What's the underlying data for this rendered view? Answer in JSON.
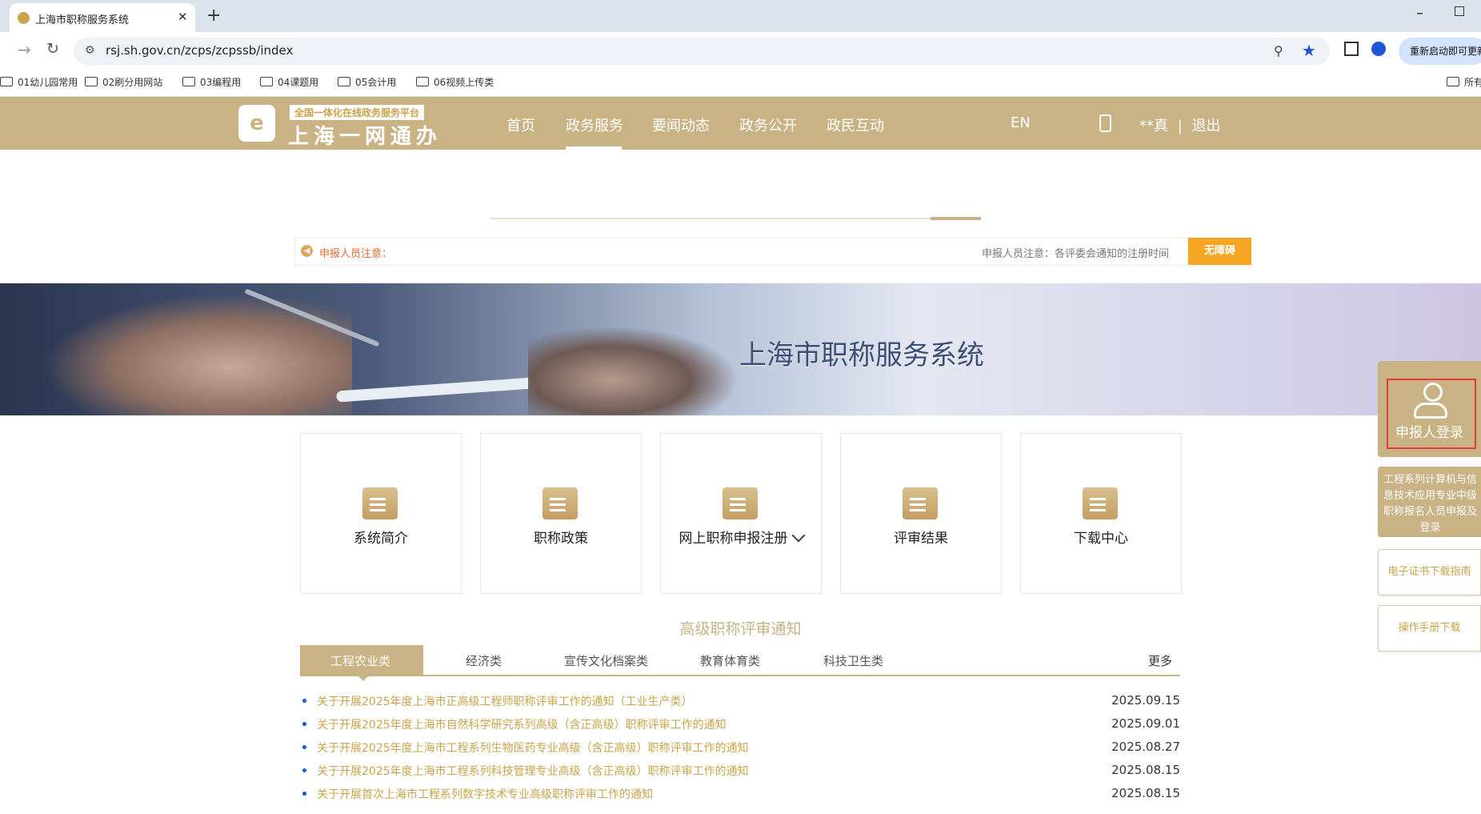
{
  "browser": {
    "tab_title": "上海市职称服务系统",
    "tab_close": "✕",
    "new_tab": "+",
    "url": "rsj.sh.gov.cn/zcps/zcpssb/index",
    "relaunch_label": "重新启动即可更新",
    "bookmarks": [
      "01幼儿园常用",
      "02刷分用网站",
      "03编程用",
      "04课题用",
      "05会计用",
      "06视频上传类"
    ],
    "bookmarks_right": "所有"
  },
  "header": {
    "logo_top": "全国一体化在线政务服务平台",
    "logo_main": "上海一网通办",
    "nav": [
      "首页",
      "政务服务",
      "要闻动态",
      "政务公开",
      "政民互动"
    ],
    "lang": "EN",
    "user_name": "**真",
    "separator": "|",
    "logout": "退出"
  },
  "notice": {
    "label": "申报人员注意：",
    "marquee": "申报人员注意：各评委会通知的注册时间",
    "accessible_button": "无障碍"
  },
  "banner": {
    "title": "上海市职称服务系统"
  },
  "services": [
    {
      "label": "系统简介",
      "icon": "document-icon"
    },
    {
      "label": "职称政策",
      "icon": "clipboard-icon"
    },
    {
      "label": "网上职称申报注册",
      "icon": "id-card-icon"
    },
    {
      "label": "评审结果",
      "icon": "presentation-icon"
    },
    {
      "label": "下载中心",
      "icon": "download-box-icon"
    }
  ],
  "notices": {
    "section_title": "高级职称评审通知",
    "tabs": [
      "工程农业类",
      "经济类",
      "宣传文化档案类",
      "教育体育类",
      "科技卫生类"
    ],
    "more": "更多",
    "items": [
      {
        "title": "关于开展2025年度上海市正高级工程师职称评审工作的通知（工业生产类）",
        "date": "2025.09.15"
      },
      {
        "title": "关于开展2025年度上海市自然科学研究系列高级（含正高级）职称评审工作的通知",
        "date": "2025.09.01"
      },
      {
        "title": "关于开展2025年度上海市工程系列生物医药专业高级（含正高级）职称评审工作的通知",
        "date": "2025.08.27"
      },
      {
        "title": "关于开展2025年度上海市工程系列科技管理专业高级（含正高级）职称评审工作的通知",
        "date": "2025.08.15"
      },
      {
        "title": "关于开展首次上海市工程系列数字技术专业高级职称评审工作的通知",
        "date": "2025.08.15"
      }
    ]
  },
  "side_panel": {
    "login_label": "申报人登录",
    "engineering_label": "工程系列计算机与信息技术应用专业中级职称报名人员申报及登录",
    "certificate_guide": "电子证书下载指南",
    "manual_download": "操作手册下载"
  },
  "colors": {
    "brand_gold": "#c9b283",
    "notice_orange": "#e06a2c",
    "accessible_button": "#f5a623",
    "highlight_red": "#e53a3a"
  }
}
